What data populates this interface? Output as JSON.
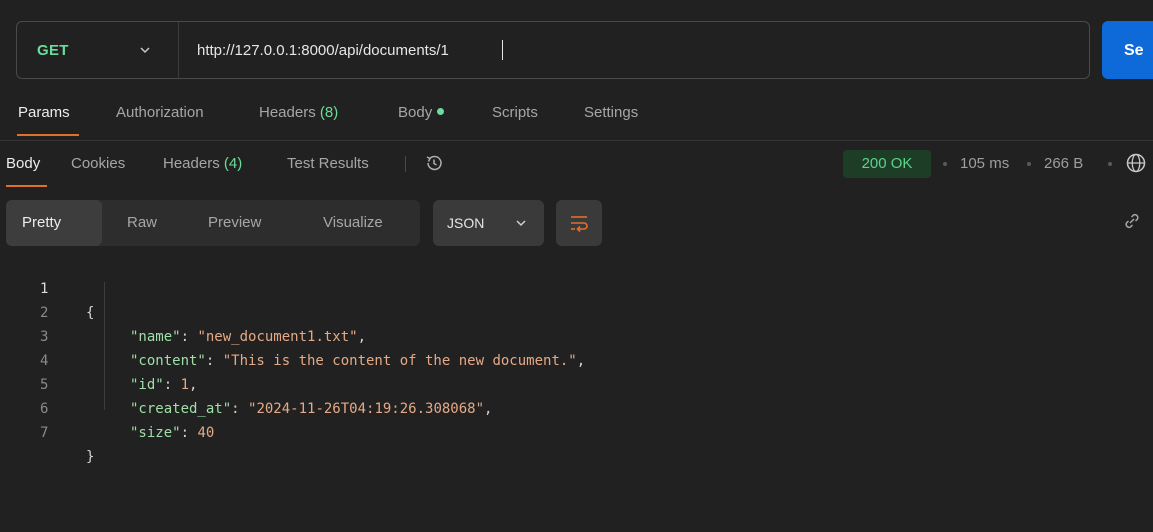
{
  "request": {
    "method": "GET",
    "url": "http://127.0.0.1:8000/api/documents/1",
    "send_label": "Se"
  },
  "request_tabs": {
    "params": "Params",
    "authorization": "Authorization",
    "headers": "Headers",
    "headers_count": "(8)",
    "body": "Body",
    "scripts": "Scripts",
    "settings": "Settings"
  },
  "response_tabs": {
    "body": "Body",
    "cookies": "Cookies",
    "headers": "Headers",
    "headers_count": "(4)",
    "test_results": "Test Results"
  },
  "response_meta": {
    "status": "200 OK",
    "time": "105 ms",
    "size": "266 B"
  },
  "view_options": {
    "pretty": "Pretty",
    "raw": "Raw",
    "preview": "Preview",
    "visualize": "Visualize",
    "format": "JSON"
  },
  "code": {
    "line_numbers": [
      "1",
      "2",
      "3",
      "4",
      "5",
      "6",
      "7"
    ],
    "open_brace": "{",
    "close_brace": "}",
    "fields": [
      {
        "key": "\"name\"",
        "value": "\"new_document1.txt\"",
        "type": "string"
      },
      {
        "key": "\"content\"",
        "value": "\"This is the content of the new document.\"",
        "type": "string"
      },
      {
        "key": "\"id\"",
        "value": "1",
        "type": "number"
      },
      {
        "key": "\"created_at\"",
        "value": "\"2024-11-26T04:19:26.308068\"",
        "type": "string"
      },
      {
        "key": "\"size\"",
        "value": "40",
        "type": "number"
      }
    ]
  },
  "colors": {
    "method": "#6bdd9a",
    "accent": "#e0702b",
    "send": "#0d6ad8",
    "status": "#5bd38a"
  },
  "icons": [
    "chevron-down-icon",
    "history-icon",
    "globe-icon",
    "wrap-lines-icon",
    "link-icon"
  ]
}
